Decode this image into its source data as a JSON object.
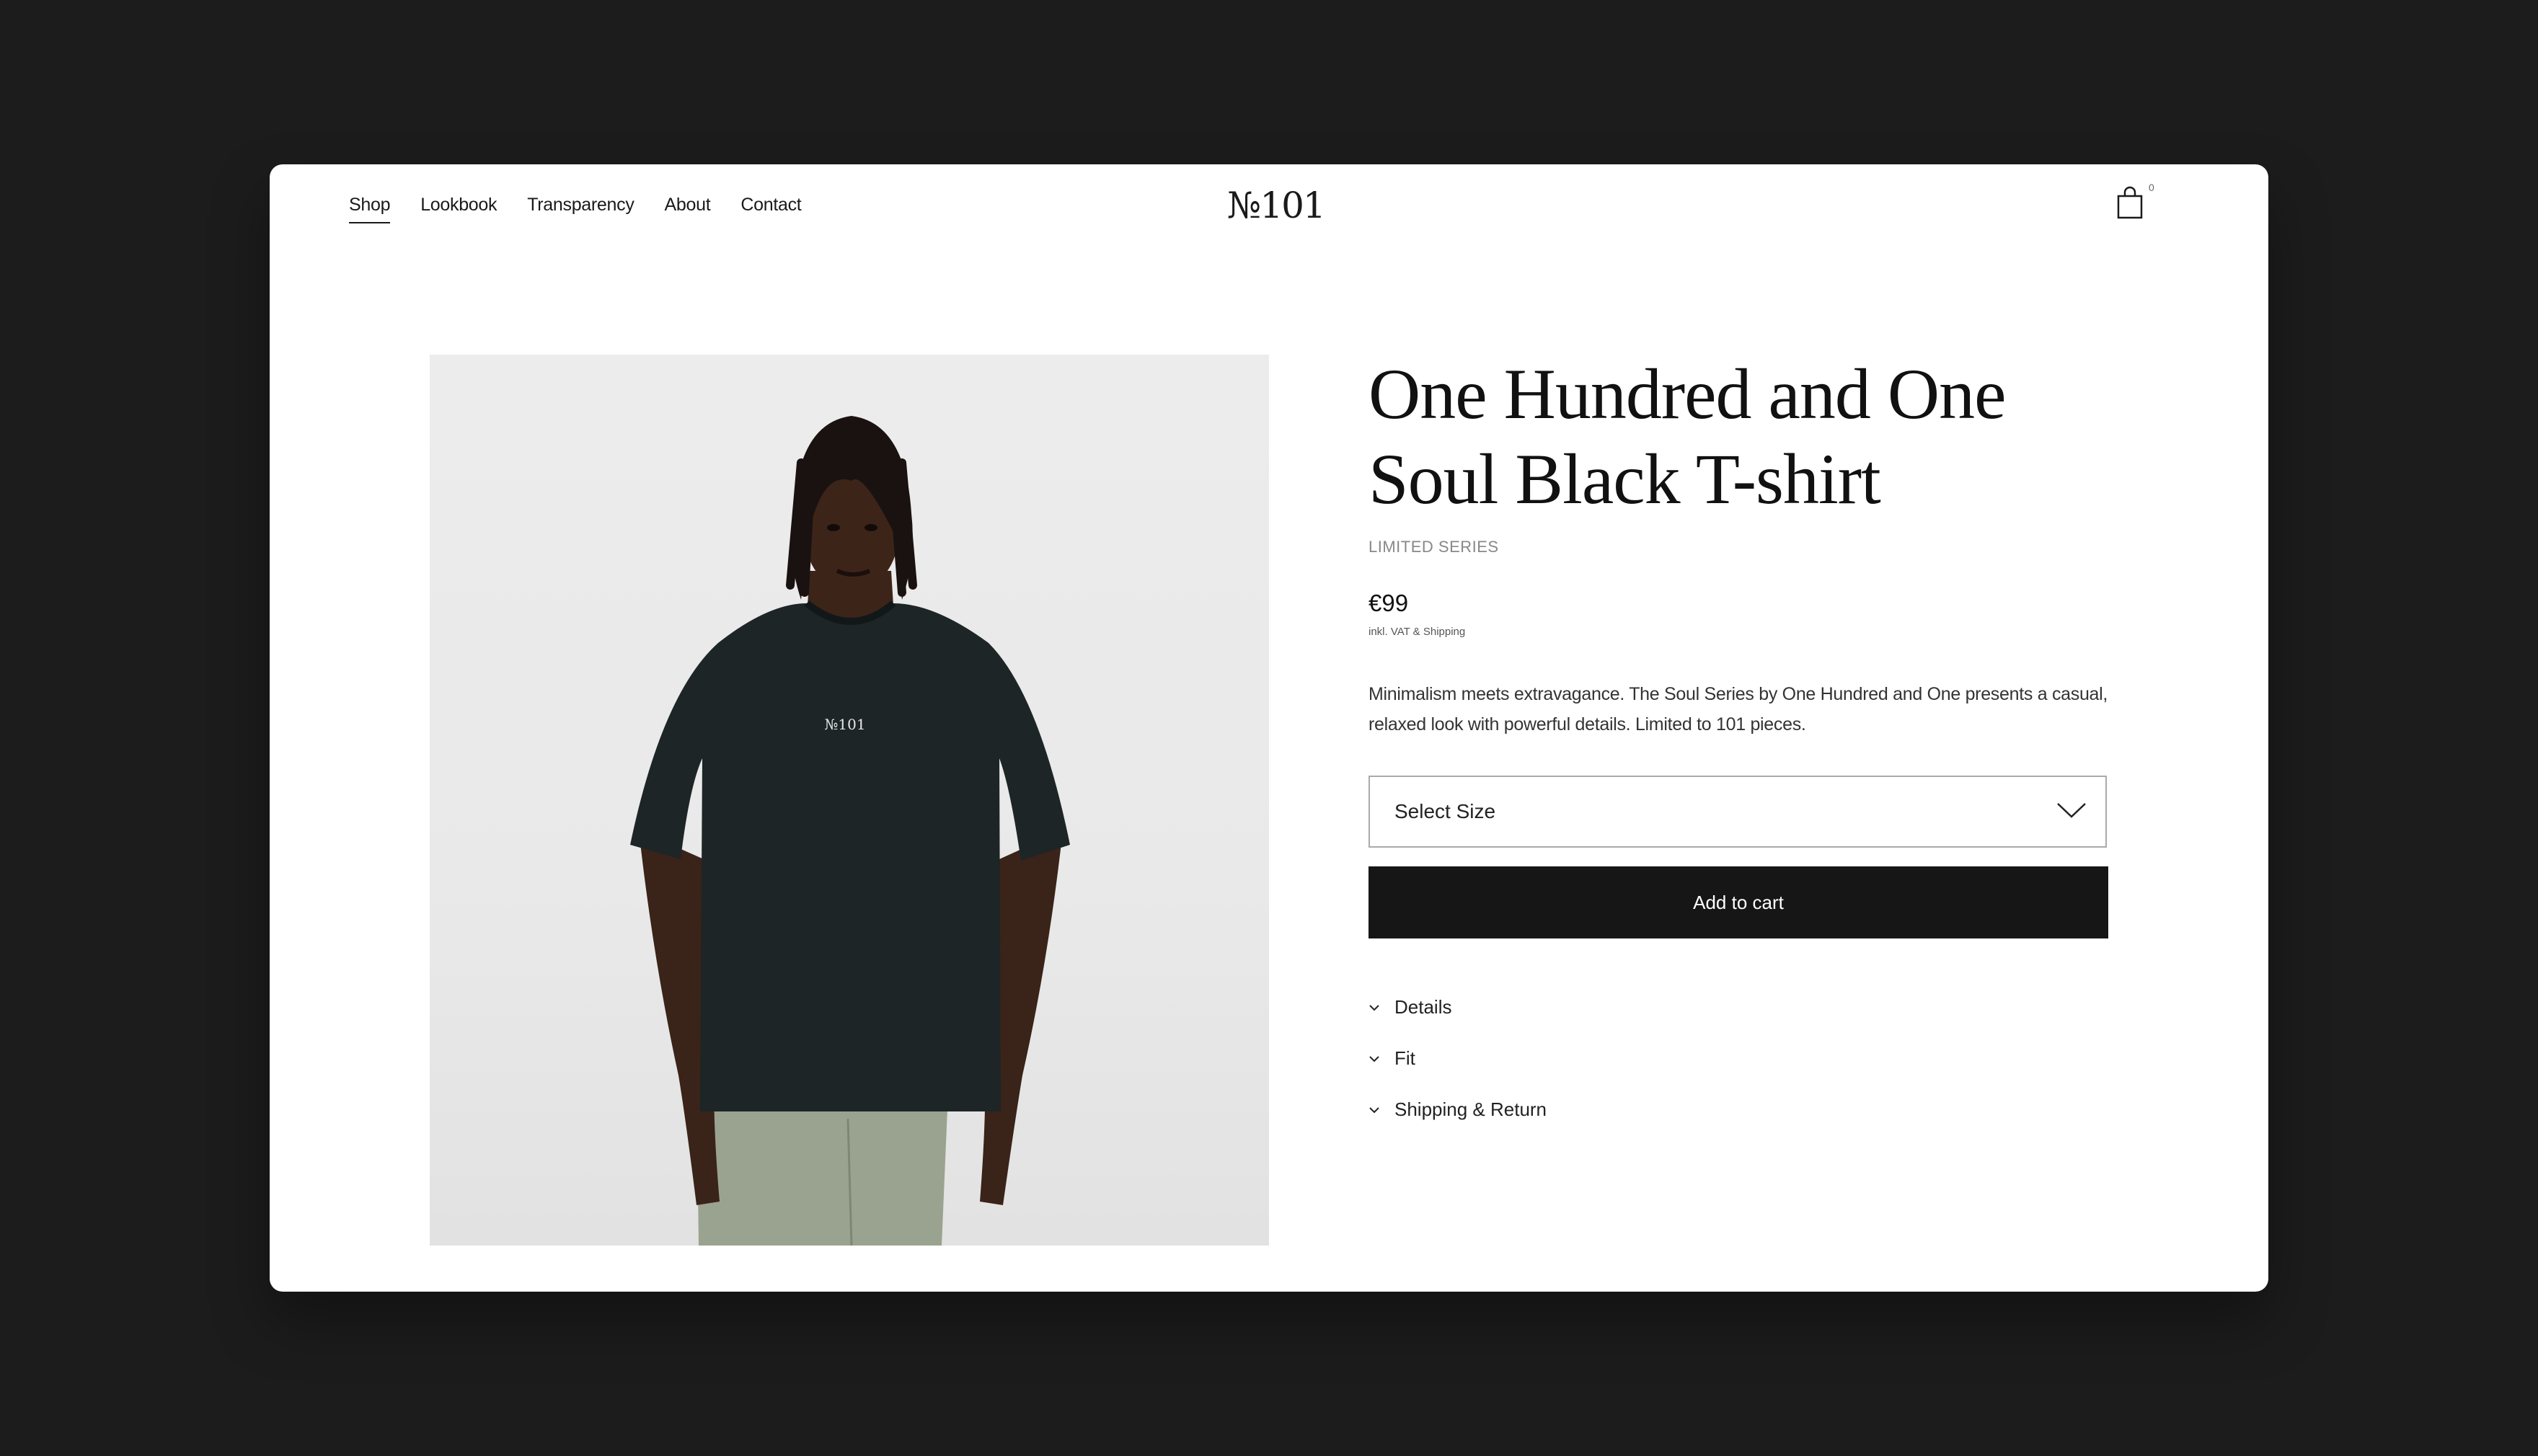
{
  "nav": {
    "items": [
      {
        "label": "Shop",
        "active": true
      },
      {
        "label": "Lookbook"
      },
      {
        "label": "Transparency"
      },
      {
        "label": "About"
      },
      {
        "label": "Contact"
      }
    ]
  },
  "brand": {
    "logo": "№101"
  },
  "cart": {
    "icon": "shopping-bag-icon",
    "count": "0"
  },
  "product": {
    "image_shirt_print": "№101",
    "title_line1": "One Hundred and One",
    "title_line2": "Soul Black T-shirt",
    "series": "LIMITED SERIES",
    "price": "€99",
    "vat_note": "inkl. VAT & Shipping",
    "description": "Minimalism meets extravagance. The Soul Series by One Hundred and One presents a casual, relaxed look with powerful details. Limited to 101 pieces.",
    "size_select": {
      "selected": "Select Size",
      "icon": "chevron-down-icon"
    },
    "add_to_cart": "Add to cart",
    "accordion": [
      {
        "label": "Details",
        "icon": "chevron-down-icon"
      },
      {
        "label": "Fit",
        "icon": "chevron-down-icon"
      },
      {
        "label": "Shipping & Return",
        "icon": "chevron-down-icon"
      }
    ]
  },
  "colors": {
    "background": "#1c1c1c",
    "surface": "#ffffff",
    "button": "#161616"
  }
}
